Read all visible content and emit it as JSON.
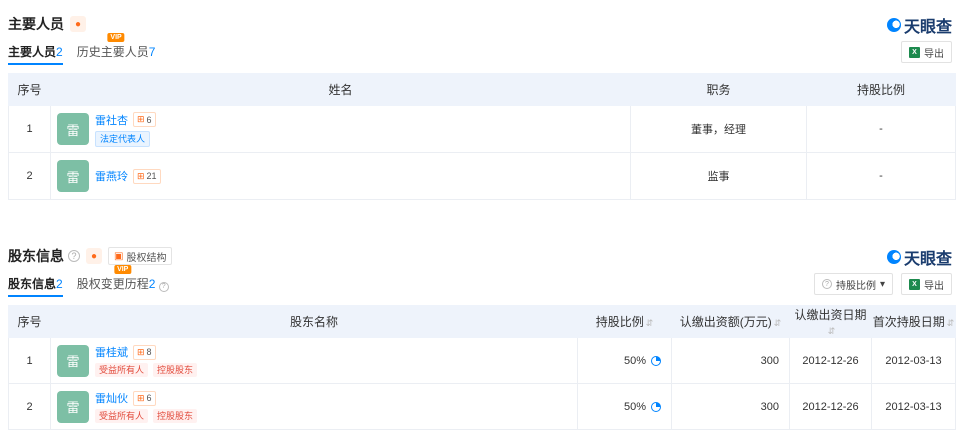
{
  "brand": "天眼查",
  "personnel": {
    "title": "主要人员",
    "tabs": [
      {
        "label": "主要人员",
        "count": "2"
      },
      {
        "label": "历史主要人员",
        "count": "7",
        "vip": "VIP"
      }
    ],
    "export_label": "导出",
    "columns": [
      "序号",
      "姓名",
      "职务",
      "持股比例"
    ],
    "rows": [
      {
        "index": "1",
        "avatar": "雷",
        "name": "雷社杏",
        "count": "6",
        "tag": "法定代表人",
        "position": "董事，经理",
        "ratio": "-"
      },
      {
        "index": "2",
        "avatar": "雷",
        "name": "雷燕玲",
        "count": "21",
        "tag": "",
        "position": "监事",
        "ratio": "-"
      }
    ]
  },
  "shareholders": {
    "title": "股东信息",
    "structure_label": "股权结构",
    "tabs": [
      {
        "label": "股东信息",
        "count": "2"
      },
      {
        "label": "股权变更历程",
        "count": "2",
        "vip": "VIP"
      }
    ],
    "ratio_filter_label": "持股比例",
    "export_label": "导出",
    "columns": [
      "序号",
      "股东名称",
      "持股比例",
      "认缴出资额(万元)",
      "认缴出资日期",
      "首次持股日期"
    ],
    "rows": [
      {
        "index": "1",
        "avatar": "雷",
        "name": "雷桂斌",
        "count": "8",
        "tags": [
          "受益所有人",
          "控股股东"
        ],
        "ratio": "50%",
        "capital": "300",
        "subscribe_date": "2012-12-26",
        "first_date": "2012-03-13"
      },
      {
        "index": "2",
        "avatar": "雷",
        "name": "雷灿伙",
        "count": "6",
        "tags": [
          "受益所有人",
          "控股股东"
        ],
        "ratio": "50%",
        "capital": "300",
        "subscribe_date": "2012-12-26",
        "first_date": "2012-03-13"
      }
    ]
  }
}
